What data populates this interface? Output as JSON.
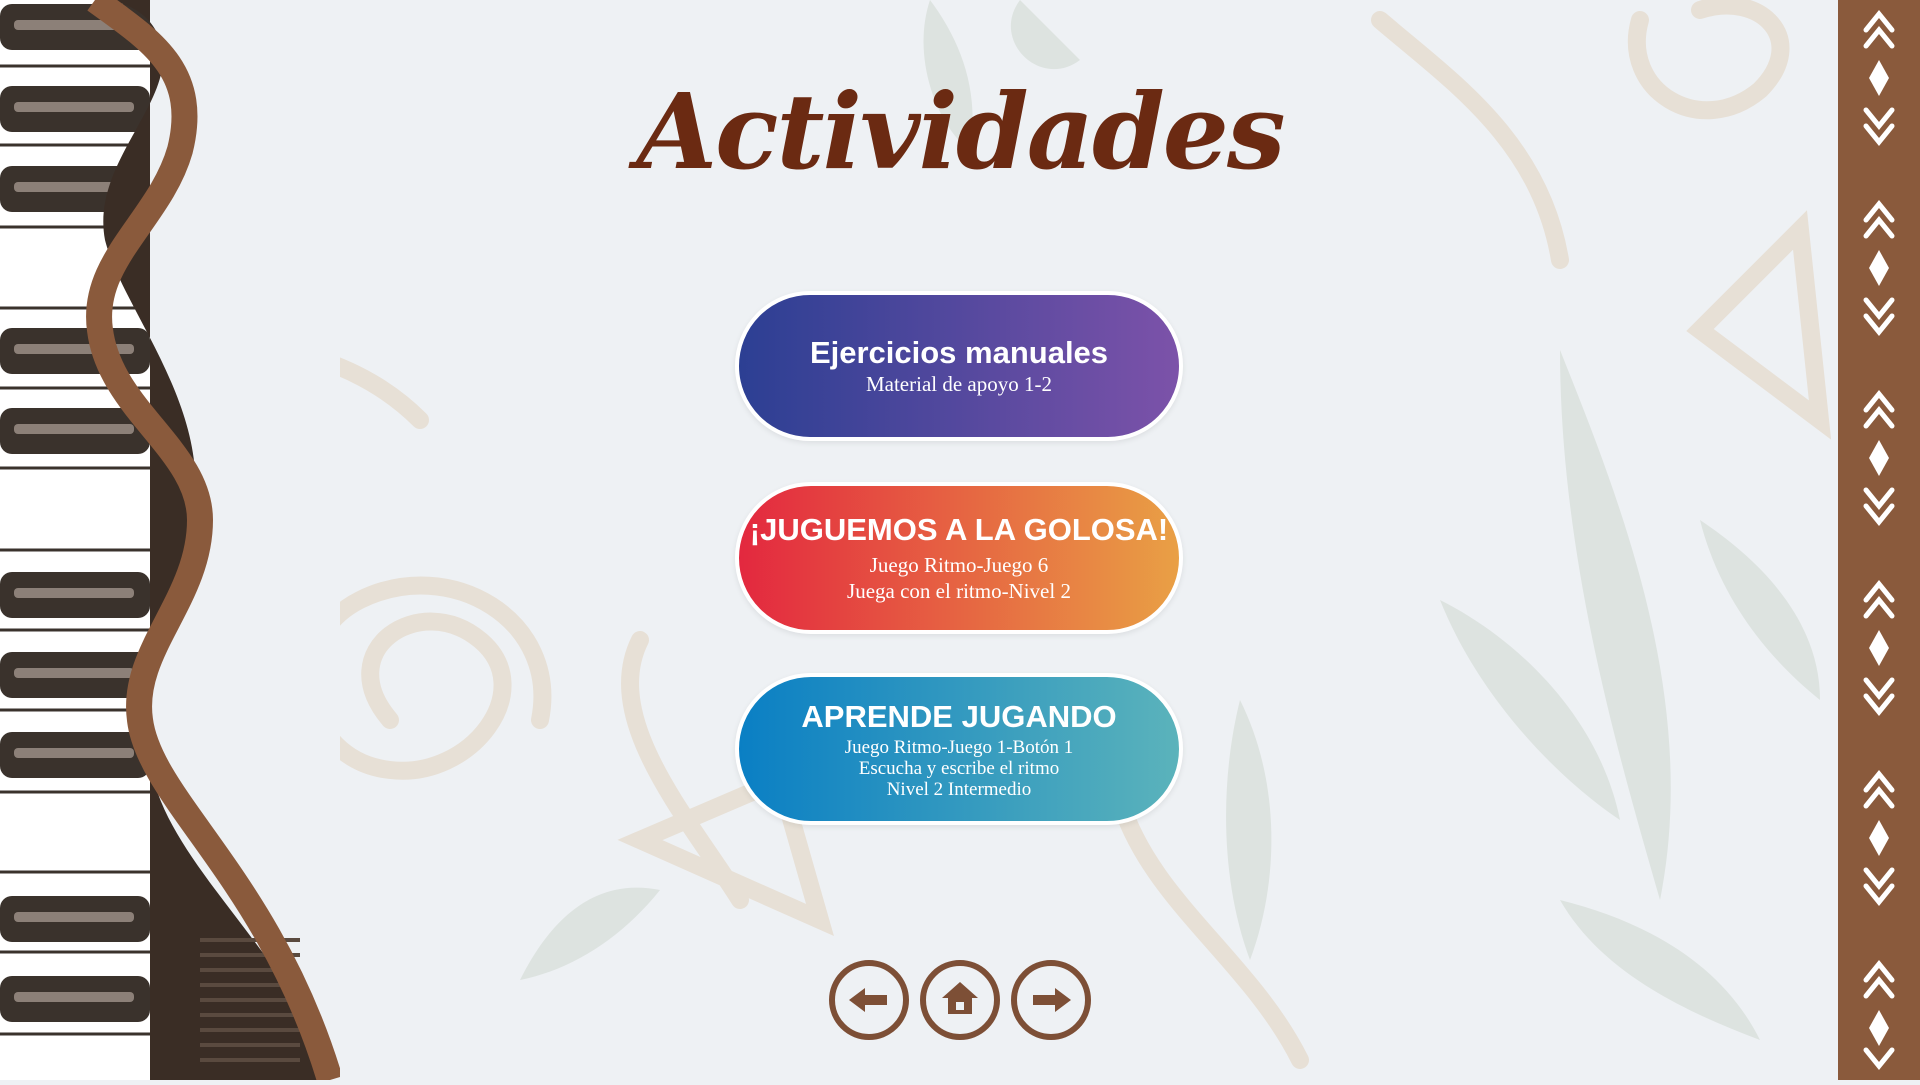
{
  "page": {
    "title": "Actividades"
  },
  "activities": [
    {
      "title": "Ejercicios manuales",
      "lines": [
        "Material de apoyo 1-2"
      ]
    },
    {
      "title": "¡JUGUEMOS A LA GOLOSA!",
      "lines": [
        "Juego Ritmo-Juego 6",
        "Juega con el ritmo-Nivel 2"
      ]
    },
    {
      "title": "APRENDE JUGANDO",
      "lines": [
        "Juego Ritmo-Juego 1-Botón 1",
        "Escucha y escribe el ritmo",
        "Nivel 2 Intermedio"
      ]
    }
  ],
  "navigation": {
    "icons": [
      "arrow-left-icon",
      "home-icon",
      "arrow-right-icon"
    ]
  },
  "colors": {
    "background": "#eef1f4",
    "title": "#6b2a12",
    "frame_brown": "#8a5a3c",
    "nav_border": "#7d4f36",
    "btn1_gradient": [
      "#2c3f93",
      "#7c52a9"
    ],
    "btn2_gradient": [
      "#e3283f",
      "#e9a045"
    ],
    "btn3_gradient": [
      "#0a7fc4",
      "#5bb3bb"
    ]
  }
}
